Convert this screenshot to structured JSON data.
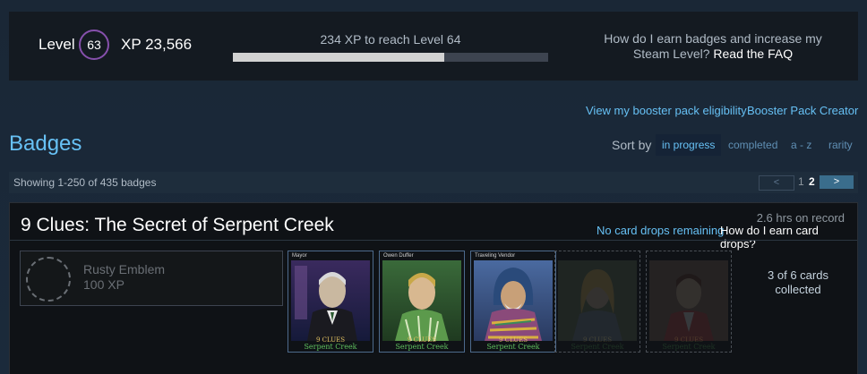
{
  "level": {
    "label": "Level",
    "value": "63",
    "xp_label": "XP 23,566",
    "next_text": "234 XP to reach Level 64",
    "progress_fraction": 0.67,
    "faq_text": "How do I earn badges and increase my Steam Level?",
    "faq_link": "Read the FAQ"
  },
  "links": {
    "booster_eligibility": "View my booster pack eligibility",
    "booster_creator": "Booster Pack Creator"
  },
  "page_title": "Badges",
  "sort": {
    "label": "Sort by",
    "options": [
      "in progress",
      "completed",
      "a - z",
      "rarity"
    ],
    "active": "in progress"
  },
  "listing": {
    "showing": "Showing 1-250 of 435 badges",
    "prev": "<",
    "pages": [
      "1",
      "2"
    ],
    "current_page": "2",
    "next": ">"
  },
  "badge": {
    "game_title": "9 Clues: The Secret of Serpent Creek",
    "hours": "2.6 hrs on record",
    "no_drops": "No card drops remaining",
    "earn_drops": "How do I earn card drops?",
    "emblem_name": "Rusty Emblem",
    "emblem_xp": "100 XP",
    "collected": "3 of 6 cards collected",
    "cards": [
      {
        "name": "Mayor",
        "owned": true,
        "logo_top": "9 CLUES",
        "logo_bottom": "Serpent Creek"
      },
      {
        "name": "Owen Duffer",
        "owned": true,
        "logo_top": "9 CLUES",
        "logo_bottom": "Serpent Creek"
      },
      {
        "name": "Traveling Vendor",
        "owned": true,
        "logo_top": "9 CLUES",
        "logo_bottom": "Serpent Creek"
      },
      {
        "name": "",
        "owned": false,
        "logo_top": "9 CLUES",
        "logo_bottom": "Serpent Creek"
      },
      {
        "name": "",
        "owned": false,
        "logo_top": "9 CLUES",
        "logo_bottom": "Serpent Creek"
      }
    ]
  },
  "colors": {
    "accent": "#67c1f5",
    "link": "#66c0f4",
    "level_ring": "#8650ac",
    "next_button": "#3a6d8c"
  }
}
